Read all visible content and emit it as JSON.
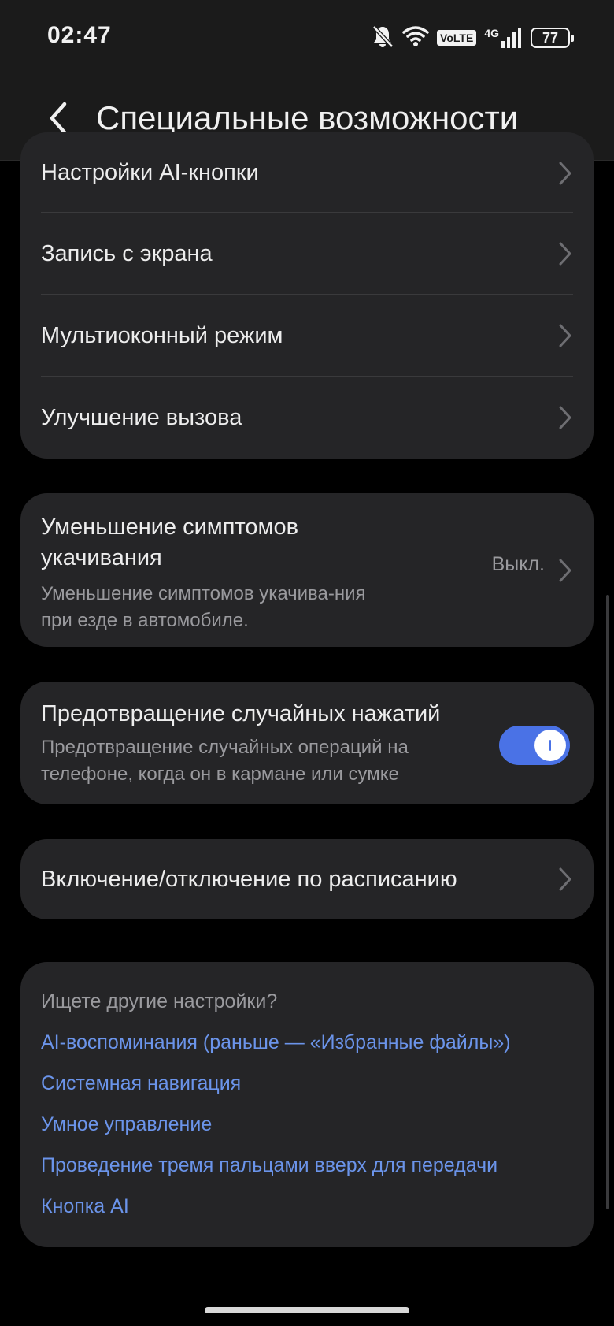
{
  "status_bar": {
    "time": "02:47",
    "volte": "VoLTE",
    "network": "4G",
    "battery": "77",
    "icons": [
      "bell-off-icon",
      "wifi-icon",
      "signal-icon",
      "battery-icon"
    ]
  },
  "header": {
    "title": "Специальные возможности",
    "back_icon": "chevron-left-icon"
  },
  "card1": {
    "items": [
      {
        "label": "Настройки AI-кнопки"
      },
      {
        "label": "Запись с экрана"
      },
      {
        "label": "Мультиоконный режим"
      },
      {
        "label": "Улучшение вызова"
      }
    ]
  },
  "motion": {
    "title": "Уменьшение симптомов укачивания",
    "subtitle": "Уменьшение симптомов укачива-ния при езде в автомобиле.",
    "value": "Выкл."
  },
  "accidental": {
    "title": "Предотвращение случайных нажатий",
    "subtitle": "Предотвращение случайных операций на телефоне, когда он в кармане или сумке",
    "enabled": true
  },
  "schedule": {
    "label": "Включение/отключение по расписанию"
  },
  "suggestions": {
    "title": "Ищете другие настройки?",
    "links": [
      "AI-воспоминания (раньше — «Избранные файлы»)",
      "Системная навигация",
      "Умное управление",
      "Проведение тремя пальцами вверх для передачи",
      "Кнопка AI"
    ]
  },
  "colors": {
    "background": "#000000",
    "card": "#252527",
    "accent": "#4a72e6",
    "link": "#6b94ea"
  }
}
